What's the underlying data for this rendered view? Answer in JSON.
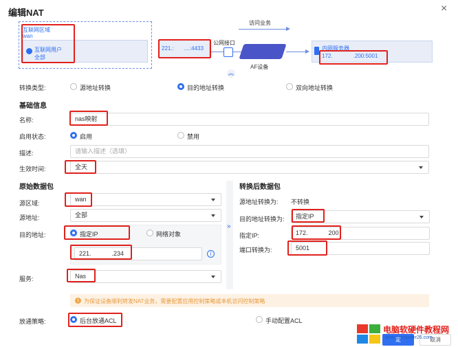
{
  "dialog": {
    "title": "编辑NAT",
    "close_symbol": "×"
  },
  "diagram": {
    "visit_label": "访问业务",
    "zone_title": "互联网区域",
    "zone_name": "wan",
    "user_title": "互联网用户",
    "user_value": "全部",
    "public_ip_left": "221.:",
    "public_ip_mid": "....",
    "public_ip_port": ":4433",
    "public_interface_label": "公网接口",
    "device_label": "AF设备",
    "server_title": "内网服务器",
    "server_ip_left": "172.",
    "server_ip_port": ".200:5001",
    "collapse_symbol": "︽"
  },
  "conversion": {
    "label": "转换类型:",
    "options": [
      "源地址转换",
      "目的地址转换",
      "双向地址转换"
    ],
    "selected_index": 1
  },
  "basic": {
    "section_title": "基础信息",
    "name_label": "名称:",
    "name_value": "nas映射",
    "status_label": "启用状态:",
    "status_options": [
      "启用",
      "禁用"
    ],
    "status_selected_index": 0,
    "desc_label": "描述:",
    "desc_placeholder": "请输入描述（选填）",
    "time_label": "生效时间:",
    "time_value": "全天"
  },
  "original": {
    "section_title": "原始数据包",
    "src_zone_label": "源区域:",
    "src_zone_value": "wan",
    "src_addr_label": "源地址:",
    "src_addr_value": "全部",
    "dst_addr_label": "目的地址:",
    "dst_options": [
      "指定IP",
      "网络对象"
    ],
    "dst_selected_index": 0,
    "dst_ip_left": "221.",
    "dst_ip_right": ".234",
    "service_label": "服务:",
    "service_value": "Nas",
    "info_symbol": "i"
  },
  "translated": {
    "section_title": "转换后数据包",
    "src_conv_label": "源地址转换为:",
    "src_conv_value": "不转换",
    "dst_conv_label": "目的地址转换为:",
    "dst_conv_value": "指定IP",
    "spec_ip_label": "指定IP:",
    "spec_ip_left": "172.",
    "spec_ip_right": "200",
    "port_label": "端口转换为:",
    "port_value": "5001"
  },
  "notice": {
    "icon": "i",
    "text": "为保证设备顺利转发NAT业务，需要配置应用控制策略或本机访问控制策略"
  },
  "policy": {
    "label": "放通策略:",
    "options": [
      "后台放通ACL",
      "手动配置ACL"
    ],
    "selected_index": 0
  },
  "footer": {
    "ok_label": "定",
    "cancel_label": "取消"
  },
  "watermark": {
    "title": "电脑软硬件教程网",
    "url": "www.computer26.com"
  },
  "colors": {
    "accent": "#2f6ff0",
    "highlight": "#e0201b",
    "device": "#4a55c8",
    "notice_bg": "#fdf1e3"
  }
}
